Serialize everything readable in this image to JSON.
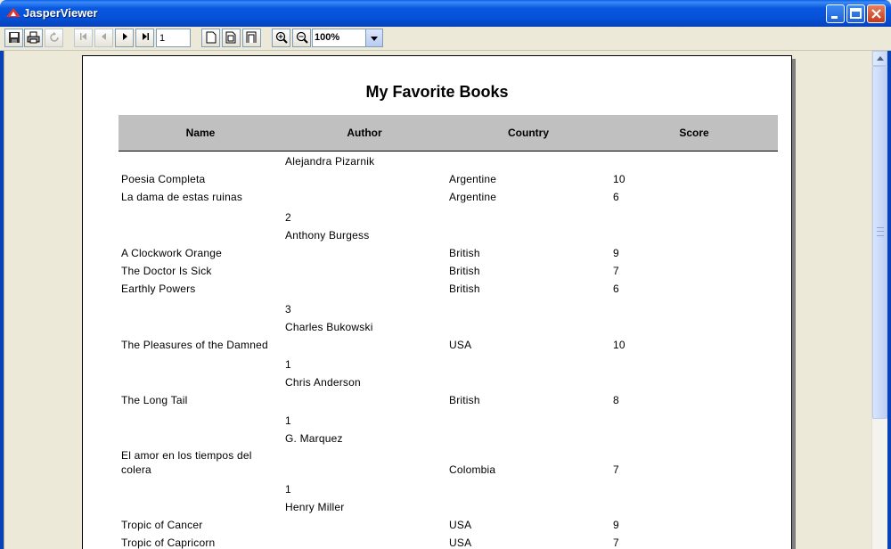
{
  "window": {
    "title": "JasperViewer"
  },
  "toolbar": {
    "page_value": "1",
    "zoom_value": "100%"
  },
  "report": {
    "title": "My Favorite Books",
    "columns": [
      "Name",
      "Author",
      "Country",
      "Score"
    ],
    "groups": [
      {
        "author": "Alejandra Pizarnik",
        "books": [
          {
            "name": "Poesia Completa",
            "country": "Argentine",
            "score": "10"
          },
          {
            "name": "La dama de estas ruinas",
            "country": "Argentine",
            "score": "6"
          }
        ],
        "count": "2"
      },
      {
        "author": "Anthony Burgess",
        "books": [
          {
            "name": "A Clockwork Orange",
            "country": "British",
            "score": "9"
          },
          {
            "name": "The Doctor Is Sick",
            "country": "British",
            "score": "7"
          },
          {
            "name": "Earthly Powers",
            "country": "British",
            "score": "6"
          }
        ],
        "count": "3"
      },
      {
        "author": "Charles Bukowski",
        "books": [
          {
            "name": "The Pleasures of the Damned",
            "country": "USA",
            "score": "10"
          }
        ],
        "count": "1"
      },
      {
        "author": "Chris Anderson",
        "books": [
          {
            "name": "The Long Tail",
            "country": "British",
            "score": "8"
          }
        ],
        "count": "1"
      },
      {
        "author": "G. Marquez",
        "books": [
          {
            "name": "El amor en los tiempos del colera",
            "country": "Colombia",
            "score": "7"
          }
        ],
        "count": "1"
      },
      {
        "author": "Henry Miller",
        "books": [
          {
            "name": "Tropic of Cancer",
            "country": "USA",
            "score": "9"
          },
          {
            "name": "Tropic of Capricorn",
            "country": "USA",
            "score": "7"
          }
        ]
      }
    ]
  }
}
